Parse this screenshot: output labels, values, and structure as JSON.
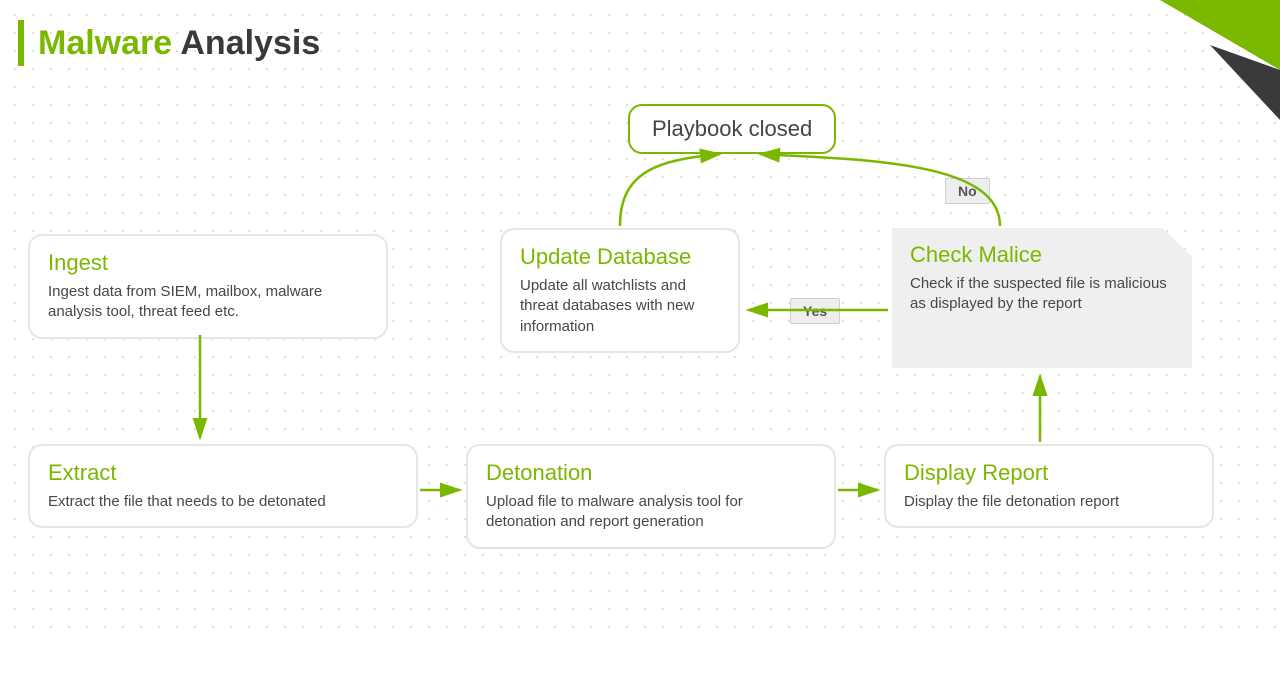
{
  "title": {
    "word1": "Malware",
    "word2": "Analysis"
  },
  "playbook_closed": "Playbook closed",
  "labels": {
    "yes": "Yes",
    "no": "No"
  },
  "nodes": {
    "ingest": {
      "title": "Ingest",
      "text": "Ingest data from SIEM, mailbox, malware analysis tool, threat feed etc."
    },
    "extract": {
      "title": "Extract",
      "text": "Extract the file that needs to be detonated"
    },
    "detonation": {
      "title": "Detonation",
      "text": "Upload file to malware analysis tool for detonation and report generation"
    },
    "display": {
      "title": "Display Report",
      "text": "Display the file detonation report"
    },
    "check": {
      "title": "Check Malice",
      "text": "Check if the suspected file is malicious as displayed by the report"
    },
    "update": {
      "title": "Update Database",
      "text": "Update all watchlists and threat databases with new information"
    }
  }
}
